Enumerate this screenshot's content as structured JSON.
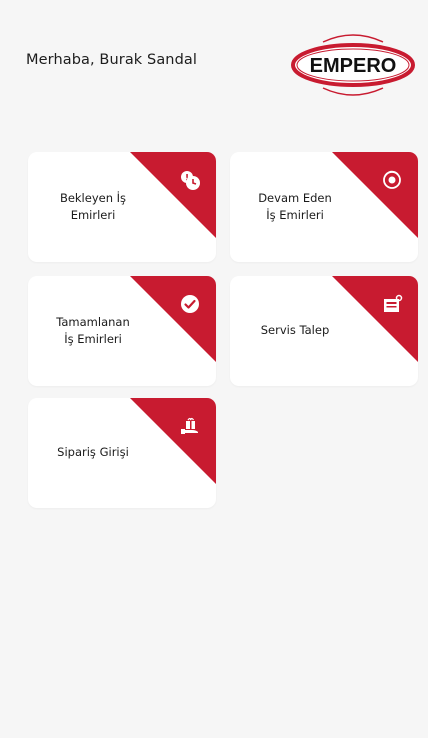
{
  "header": {
    "greeting": "Merhaba, Burak Sandal",
    "logo_text": "EMPERO"
  },
  "colors": {
    "accent": "#c81b30",
    "background": "#f6f6f6",
    "card": "#ffffff"
  },
  "cards": [
    {
      "line1": "Bekleyen İş",
      "line2": "Emirleri",
      "icon": "clock-alert-icon"
    },
    {
      "line1": "Devam Eden",
      "line2": "İş Emirleri",
      "icon": "sync-gear-icon"
    },
    {
      "line1": "Tamamlanan",
      "line2": "İş Emirleri",
      "icon": "check-circle-icon"
    },
    {
      "line1": "Servis Talep",
      "line2": "",
      "icon": "service-request-icon"
    },
    {
      "line1": "Sipariş Girişi",
      "line2": "",
      "icon": "order-entry-icon"
    }
  ]
}
